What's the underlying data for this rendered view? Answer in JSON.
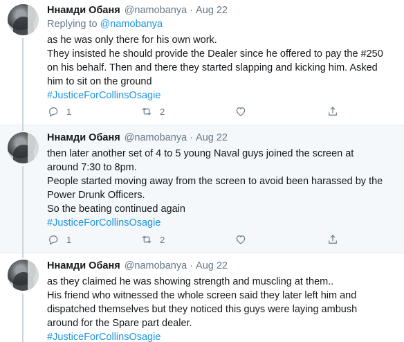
{
  "tweets": [
    {
      "name": "Ннамди Обаня",
      "handle": "@namobanya",
      "separator": "·",
      "date": "Aug 22",
      "reply_prefix": "Replying to",
      "reply_to": "@namobanya",
      "lines": [
        "as he was only there for his own work.",
        "They insisted he should provide the Dealer since he offered to pay the #250",
        "on his behalf. Then and there they started slapping and kicking him. Asked",
        "him to sit on the ground"
      ],
      "hashtag": "#JusticeForCollinsOsagie",
      "reply_count": "1",
      "retweet_count": "2",
      "like_count": "",
      "share_icon": "share-icon"
    },
    {
      "name": "Ннамди Обаня",
      "handle": "@namobanya",
      "separator": "·",
      "date": "Aug 22",
      "lines": [
        "then later another set of 4 to 5 young Naval guys joined the screen at",
        "around 7:30 to 8pm.",
        "People started moving away from the screen to avoid been harassed by the",
        "Power Drunk Officers.",
        "So the beating continued again"
      ],
      "hashtag": "#JusticeForCollinsOsagie",
      "reply_count": "1",
      "retweet_count": "2",
      "like_count": ""
    },
    {
      "name": "Ннамди Обаня",
      "handle": "@namobanya",
      "separator": "·",
      "date": "Aug 22",
      "lines": [
        "as they claimed he was showing strength and muscling at them..",
        "His friend who witnessed  the whole screen said they later left him and",
        "dispatched themselves but they noticed this guys were laying ambush",
        "around for the Spare part dealer."
      ],
      "hashtag": "#JusticeForCollinsOsagie"
    }
  ],
  "colors": {
    "link": "#1b95e0",
    "secondary_text": "#657786",
    "thread_line": "#ccd6dd",
    "highlight_bg": "#f5f8fa"
  }
}
